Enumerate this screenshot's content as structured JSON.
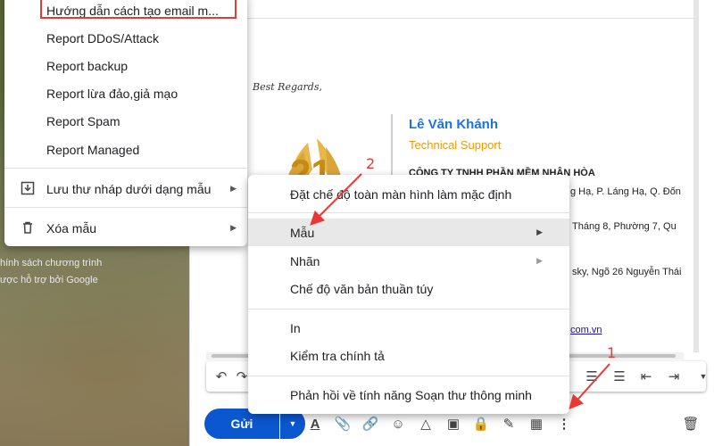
{
  "background": {
    "text_line1": "hính sách chương trình",
    "text_line2": "ược hỗ trợ bởi Google"
  },
  "compose": {
    "best_regards": "Best Regards,",
    "signature": {
      "name": "Lê Văn Khánh",
      "role": "Technical Support",
      "company": "CÔNG TY TNHH PHẦN MỀM NHÂN HÒA",
      "line1": "g Hạ, P. Láng Hạ, Q. Đốn",
      "line2": "Tháng 8, Phường 7, Qu",
      "line3": "sky, Ngõ 26 Nguyễn Thái",
      "link": "com.vn"
    },
    "send_label": "Gửi"
  },
  "left_menu": {
    "highlighted_item": "Hướng dẫn cách tạo email m...",
    "items": [
      "Report DDoS/Attack",
      "Report backup",
      "Report lừa đảo,giả mạo",
      "Report Spam",
      "Report Managed"
    ],
    "save_draft_as_template": "Lưu thư nháp dưới dạng mẫu",
    "delete_template": "Xóa mẫu"
  },
  "right_menu": {
    "items": [
      "Đặt chế độ toàn màn hình làm mặc định",
      "Mẫu",
      "Nhãn",
      "Chế độ văn bản thuần túy",
      "In",
      "Kiểm tra chính tả",
      "Phản hồi về tính năng Soạn thư thông minh"
    ]
  },
  "annotations": {
    "step1": "1",
    "step2": "2"
  },
  "colors": {
    "send": "#0b57d0",
    "link": "#1a73e8",
    "role": "#f29900",
    "annotation": "#e53935"
  }
}
